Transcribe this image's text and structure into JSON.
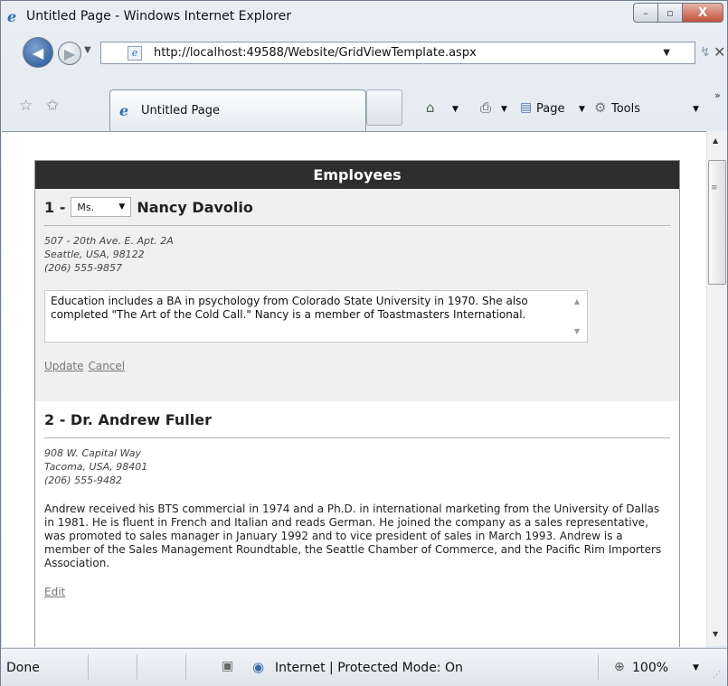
{
  "window": {
    "title": "Untitled Page - Windows Internet Explorer",
    "close_glyph": "X",
    "min_glyph": "–",
    "max_glyph": "▫"
  },
  "nav": {
    "url": "http://localhost:49588/Website/GridViewTemplate.aspx",
    "back_glyph": "◀",
    "forward_glyph": "▶",
    "dropdown_glyph": "▼",
    "refresh_glyph": "↯",
    "stop_glyph": "✕"
  },
  "tabs": [
    {
      "label": "Untitled Page"
    }
  ],
  "commands": {
    "page_label": "Page",
    "tools_label": "Tools",
    "more_glyph": "»"
  },
  "grid": {
    "header": "Employees",
    "records": [
      {
        "number_prefix": "1 -",
        "title_select_value": "Ms.",
        "name": "Nancy Davolio",
        "address_line1": "507 - 20th Ave. E. Apt. 2A",
        "address_line2": "Seattle, USA, 98122",
        "phone": "(206) 555-9857",
        "notes": "Education includes a BA in psychology from Colorado State University in 1970.  She also completed \"The Art of the Cold Call.\"  Nancy is a member of Toastmasters International.",
        "update_label": "Update",
        "cancel_label": "Cancel"
      },
      {
        "heading": "2 - Dr. Andrew Fuller",
        "address_line1": "908 W. Capital Way",
        "address_line2": "Tacoma, USA, 98401",
        "phone": "(206) 555-9482",
        "notes": "Andrew received his BTS commercial in 1974 and a Ph.D. in international marketing from the University of Dallas in 1981. He is fluent in French and Italian and reads German. He joined the company as a sales representative, was promoted to sales manager in January 1992 and to vice president of sales in March 1993. Andrew is a member of the Sales Management Roundtable, the Seattle Chamber of Commerce, and the Pacific Rim Importers Association.",
        "edit_label": "Edit"
      }
    ]
  },
  "status": {
    "text": "Done",
    "zone": "Internet | Protected Mode: On",
    "zoom": "100%"
  },
  "colors": {
    "grid_header_bg": "#2e2e2e",
    "editing_row_bg": "#f0f0f0",
    "link_color": "#777777"
  },
  "icons": {
    "browser": "ie-logo-icon",
    "favorites": "favorites-star-icon",
    "add_favorites": "add-favorites-icon",
    "home": "home-icon",
    "print": "printer-icon",
    "page": "page-icon",
    "tools": "gear-icon",
    "globe": "globe-icon",
    "zoom": "magnifier-icon"
  }
}
